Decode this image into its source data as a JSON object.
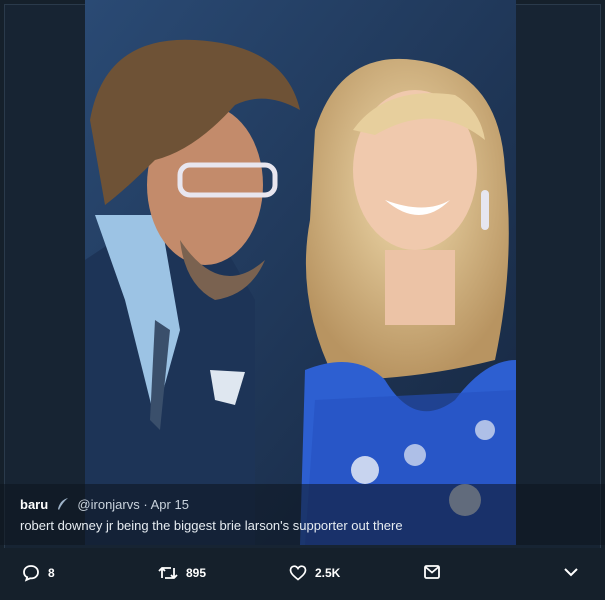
{
  "tweet": {
    "author_name": "baru",
    "author_icon": "feather-icon",
    "handle": "@ironjarvs",
    "separator": "·",
    "date": "Apr 15",
    "text": "robert downey jr being the biggest brie larson's supporter out there"
  },
  "actions": {
    "reply_icon": "reply-icon",
    "reply_count": "8",
    "retweet_icon": "retweet-icon",
    "retweet_count": "895",
    "like_icon": "heart-icon",
    "like_count": "2.5K",
    "dm_icon": "envelope-icon",
    "more_icon": "chevron-down-icon"
  },
  "colors": {
    "background": "#15202b",
    "frame": "#172433",
    "text_secondary": "#c9d3dd"
  }
}
